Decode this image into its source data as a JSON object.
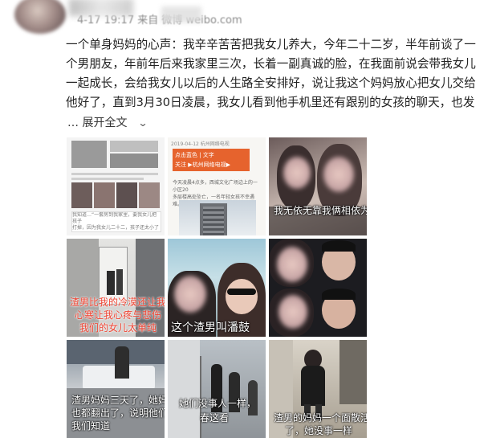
{
  "post": {
    "meta": "4-17 19:17 来自 微博 weibo.com",
    "lines": [
      "一个单身妈妈的心声：我辛辛苦苦把我女儿养大，今年二十二岁，半年前谈了一",
      "个男朋友，年前年后来我家里三次，长着一副真诚的脸，在我面前说会带我女儿",
      "一起成长，会给我女儿以后的人生路全安排好，说让我这个妈妈放心把女儿交给",
      "他好了，直到3月30日凌晨，我女儿看到他手机里还有跟别的女孩的聊天，也发"
    ],
    "expand_label": "展开全文",
    "expand_prefix": "…",
    "expand_icon": "chevron-down-icon"
  },
  "images": [
    {
      "id": 1,
      "captions": [
        "我知道…“一套房到我家里，要我女儿把孩子",
        "打掉，因为我女儿二十二，孩子还太小了"
      ]
    },
    {
      "id": 2,
      "header": "2019-04-12 杭州网络电视",
      "tag": "点击蓝色 | 文字",
      "tag2": "关注 ▶杭州网络电视▶",
      "body": [
        "今天凌晨4点多，西城文化广场边上的一小区20",
        "多层楼高处坠亡，一名年轻女孩不幸遇难。"
      ]
    },
    {
      "id": 3,
      "captions": [
        "我无依无靠，",
        "我俩相依为命"
      ]
    },
    {
      "id": 4,
      "captions": [
        "渣男比我的冷漠还让我们",
        "心寒让我心疼与悲伤",
        "我们的女儿太单纯"
      ]
    },
    {
      "id": 5,
      "captions": [
        "这个渣男叫潘鼓"
      ]
    },
    {
      "id": 6,
      "captions": []
    },
    {
      "id": 7,
      "captions": [
        "渣男妈妈三天了，她妈妈",
        "也都翻出了，说明他们家的",
        "我们知道"
      ]
    },
    {
      "id": 8,
      "captions": [
        "她们没事人一样，",
        "春这看"
      ]
    },
    {
      "id": 9,
      "captions": [
        "渣男的妈妈一个面散活般没",
        "了，她没事一样"
      ]
    }
  ]
}
